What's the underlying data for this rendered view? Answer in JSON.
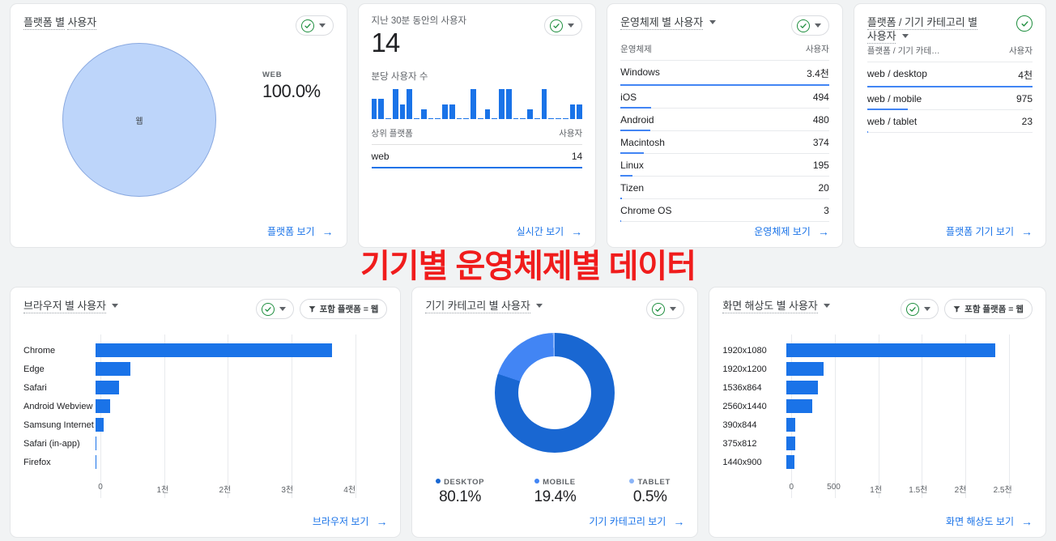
{
  "overlay": {
    "red_title": "기기별 운영체제별 데이터",
    "red_color": "#f01c1c"
  },
  "colors": {
    "accent_blue": "#1a73e8",
    "bar_blue": "#4285f4",
    "pie_fill": "#bdd5fa",
    "check_green": "#1e8e3e"
  },
  "cards": {
    "platform_users": {
      "title_main": "플랫폼 별",
      "title_tail": "사용자",
      "pie_slice_label": "웹",
      "legend_label": "WEB",
      "legend_value": "100.0%",
      "link": "플랫폼 보기",
      "arrow": "→"
    },
    "realtime": {
      "subtitle": "지난 30분 동안의 사용자",
      "big_value": "14",
      "spark_label": "분당 사용자 수",
      "table_col1": "상위 플랫폼",
      "table_col2": "사용자",
      "row_name": "web",
      "row_value": "14",
      "link": "실시간 보기",
      "arrow": "→"
    },
    "os_users": {
      "title": "운영체제 별 사용자",
      "col_dimension": "운영체제",
      "col_metric": "사용자",
      "link": "운영체제 보기",
      "arrow": "→",
      "rows": [
        {
          "name": "Windows",
          "value": "3.4천",
          "pct": 100
        },
        {
          "name": "iOS",
          "value": "494",
          "pct": 14.5
        },
        {
          "name": "Android",
          "value": "480",
          "pct": 14.1
        },
        {
          "name": "Macintosh",
          "value": "374",
          "pct": 11.0
        },
        {
          "name": "Linux",
          "value": "195",
          "pct": 5.7
        },
        {
          "name": "Tizen",
          "value": "20",
          "pct": 0.6
        },
        {
          "name": "Chrome OS",
          "value": "3",
          "pct": 0.1
        }
      ]
    },
    "platform_device": {
      "title_line1": "플랫폼 / 기기 카테고리 별",
      "title_line2": "사용자",
      "col_dimension": "플랫폼 / 기기 카테…",
      "col_metric": "사용자",
      "link": "플랫폼 기기 보기",
      "arrow": "→",
      "rows": [
        {
          "name": "web / desktop",
          "value": "4천",
          "pct": 100
        },
        {
          "name": "web / mobile",
          "value": "975",
          "pct": 24.4
        },
        {
          "name": "web / tablet",
          "value": "23",
          "pct": 0.6
        }
      ]
    },
    "browser_users": {
      "title": "브라우저 별 사용자",
      "filter_chip": "포함 플랫폼 = 웹",
      "link": "브라우저 보기",
      "arrow": "→"
    },
    "device_category": {
      "title": "기기 카테고리 별 사용자",
      "link": "기기 카테고리 보기",
      "arrow": "→"
    },
    "screen_resolution": {
      "title": "화면 해상도 별 사용자",
      "filter_chip": "포함 플랫폼 = 웹",
      "link": "화면 해상도 보기",
      "arrow": "→"
    }
  },
  "chart_data": [
    {
      "type": "pie",
      "title": "플랫폼 별 사용자",
      "categories": [
        "웹"
      ],
      "values": [
        100.0
      ],
      "labels": [
        "WEB"
      ],
      "value_labels": [
        "100.0%"
      ],
      "colors": [
        "#bdd5fa"
      ]
    },
    {
      "type": "bar",
      "title": "분당 사용자 수",
      "subtitle": "지난 30분 동안의 사용자",
      "total": 14,
      "categories": [
        "-30",
        "-29",
        "-28",
        "-27",
        "-26",
        "-25",
        "-24",
        "-23",
        "-22",
        "-21",
        "-20",
        "-19",
        "-18",
        "-17",
        "-16",
        "-15",
        "-14",
        "-13",
        "-12",
        "-11",
        "-10",
        "-9",
        "-8",
        "-7",
        "-6",
        "-5",
        "-4",
        "-3",
        "-2",
        "-1"
      ],
      "values": [
        2,
        2,
        0,
        3,
        1.5,
        3,
        0,
        1,
        0,
        0,
        1.5,
        1.5,
        0,
        0,
        3,
        0,
        1,
        0,
        3,
        3,
        0,
        0,
        1,
        0,
        3,
        0,
        0,
        0,
        1.5,
        1.5
      ],
      "xlabel": "",
      "ylabel": "",
      "grid": false
    },
    {
      "type": "table",
      "title": "운영체제 별 사용자",
      "columns": [
        "운영체제",
        "사용자"
      ],
      "rows": [
        [
          "Windows",
          "3.4천"
        ],
        [
          "iOS",
          "494"
        ],
        [
          "Android",
          "480"
        ],
        [
          "Macintosh",
          "374"
        ],
        [
          "Linux",
          "195"
        ],
        [
          "Tizen",
          "20"
        ],
        [
          "Chrome OS",
          "3"
        ]
      ]
    },
    {
      "type": "table",
      "title": "플랫폼 / 기기 카테고리 별 사용자",
      "columns": [
        "플랫폼 / 기기 카테…",
        "사용자"
      ],
      "rows": [
        [
          "web / desktop",
          "4천"
        ],
        [
          "web / mobile",
          "975"
        ],
        [
          "web / tablet",
          "23"
        ]
      ]
    },
    {
      "type": "bar",
      "orientation": "horizontal",
      "title": "브라우저 별 사용자",
      "categories": [
        "Chrome",
        "Edge",
        "Safari",
        "Android Webview",
        "Samsung Internet",
        "Safari (in-app)",
        "Firefox"
      ],
      "values": [
        3650,
        540,
        360,
        230,
        130,
        15,
        4
      ],
      "xlabel": "",
      "ylabel": "",
      "xlim": [
        0,
        4400
      ],
      "tick_values": [
        0,
        1000,
        2000,
        3000,
        4000
      ],
      "tick_labels": [
        "0",
        "1천",
        "2천",
        "3천",
        "4천"
      ],
      "grid": true,
      "color": "#1a73e8"
    },
    {
      "type": "pie",
      "variant": "donut",
      "title": "기기 카테고리 별 사용자",
      "categories": [
        "DESKTOP",
        "MOBILE",
        "TABLET"
      ],
      "values": [
        80.1,
        19.4,
        0.5
      ],
      "value_labels": [
        "80.1%",
        "19.4%",
        "0.5%"
      ],
      "colors": [
        "#1967d2",
        "#4285f4",
        "#8ab4f8"
      ],
      "legend_position": "bottom"
    },
    {
      "type": "bar",
      "orientation": "horizontal",
      "title": "화면 해상도 별 사용자",
      "categories": [
        "1920x1080",
        "1920x1200",
        "1536x864",
        "2560x1440",
        "390x844",
        "375x812",
        "1440x900"
      ],
      "values": [
        2350,
        420,
        355,
        290,
        100,
        95,
        90
      ],
      "xlabel": "",
      "ylabel": "",
      "xlim": [
        0,
        2700
      ],
      "tick_values": [
        0,
        500,
        1000,
        1500,
        2000,
        2500
      ],
      "tick_labels": [
        "0",
        "500",
        "1천",
        "1.5천",
        "2천",
        "2.5천"
      ],
      "grid": true,
      "color": "#1a73e8"
    }
  ]
}
